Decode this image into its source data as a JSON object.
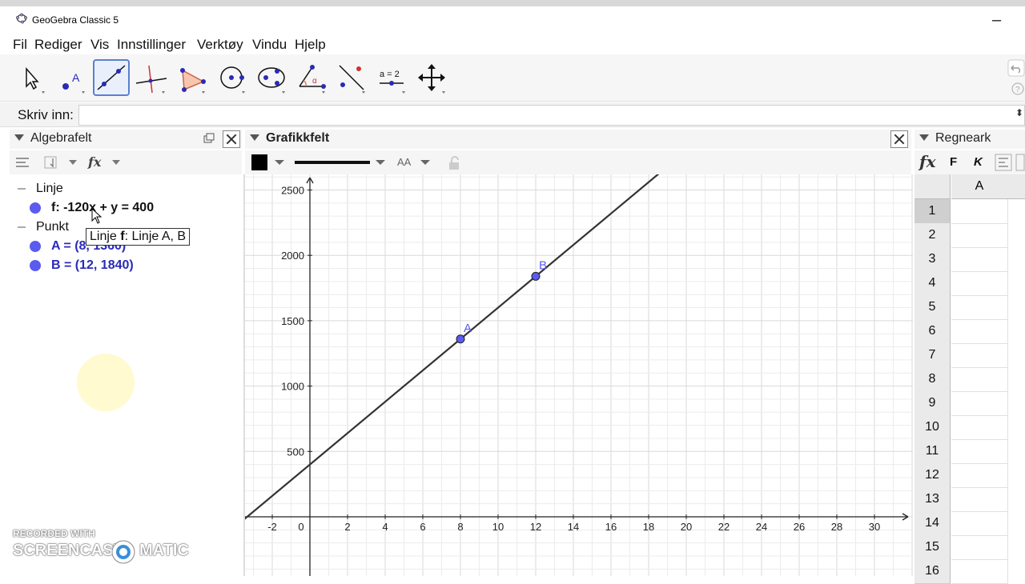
{
  "window": {
    "title": "GeoGebra Classic 5",
    "close_glyph": "–"
  },
  "menu": [
    "Fil",
    "Rediger",
    "Vis",
    "Innstillinger",
    "Verktøy",
    "Vindu",
    "Hjelp"
  ],
  "toolbar": {
    "tools": [
      "move-tool",
      "point-tool",
      "line-tool",
      "perpendicular-line-tool",
      "polygon-tool",
      "circle-tool",
      "conic-tool",
      "angle-tool",
      "reflect-tool",
      "slider-tool",
      "move-graphics-view-tool"
    ],
    "active_tool": "line-tool",
    "slider_label": "a = 2"
  },
  "input": {
    "label": "Skriv inn:",
    "value": ""
  },
  "algebra": {
    "title": "Algebrafelt",
    "categories": [
      {
        "name": "Linje",
        "items": [
          {
            "text": "f: -120x + y = 400"
          }
        ]
      },
      {
        "name": "Punkt",
        "items": [
          {
            "text": "A = (8, 1360)"
          },
          {
            "text": "B = (12, 1840)"
          }
        ]
      }
    ],
    "tooltip_prefix": "Linje ",
    "tooltip_bold": "f",
    "tooltip_suffix": ": Linje A, B"
  },
  "graphics": {
    "title": "Grafikkfelt",
    "font_toggle": "AA",
    "x_ticks": [
      "-2",
      "0",
      "2",
      "4",
      "6",
      "8",
      "10",
      "12",
      "14",
      "16",
      "18",
      "20",
      "22",
      "24",
      "26",
      "28",
      "30"
    ],
    "y_ticks": [
      "500",
      "1000",
      "1500",
      "2000",
      "2500"
    ],
    "points": [
      {
        "label": "A",
        "x": 8,
        "y": 1360
      },
      {
        "label": "B",
        "x": 12,
        "y": 1840
      }
    ],
    "line": {
      "slope": 120,
      "intercept": 400
    },
    "point_color": "#5b5bf0",
    "line_color": "#333333"
  },
  "spreadsheet": {
    "title": "Regneark",
    "style_buttons": [
      "fx",
      "F",
      "K"
    ],
    "column": "A",
    "rows": [
      "1",
      "2",
      "3",
      "4",
      "5",
      "6",
      "7",
      "8",
      "9",
      "10",
      "11",
      "12",
      "13",
      "14",
      "15",
      "16"
    ]
  },
  "watermark": {
    "line1": "RECORDED WITH",
    "line2": "SCREENCAST",
    "line3": "MATIC"
  }
}
